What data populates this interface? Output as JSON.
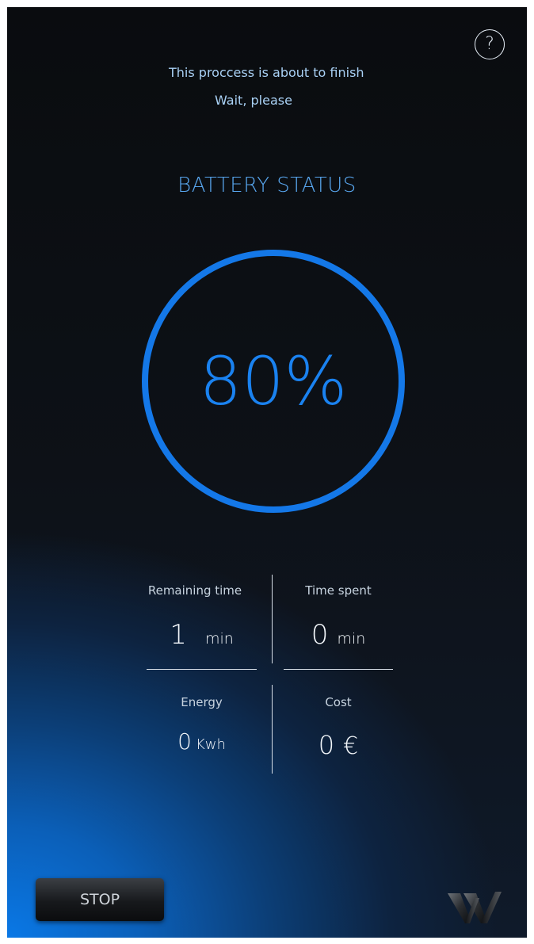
{
  "header": {
    "message_line1": "This proccess is about to finish",
    "message_line2": "Wait, please",
    "help_label": "?"
  },
  "battery": {
    "title": "BATTERY STATUS",
    "percent_text": "80%",
    "percent_value": 80,
    "ring_color": "#1478e8"
  },
  "stats": {
    "remaining_time": {
      "label": "Remaining time",
      "value": "1",
      "unit": "min"
    },
    "time_spent": {
      "label": "Time spent",
      "value": "0",
      "unit": "min"
    },
    "energy": {
      "label": "Energy",
      "value": "0",
      "unit": "Kwh"
    },
    "cost": {
      "label": "Cost",
      "value": "0",
      "unit": "€"
    }
  },
  "footer": {
    "stop_label": "STOP",
    "logo_icon": "w-logo-icon"
  },
  "colors": {
    "accent": "#1a82f0",
    "text_light": "#a9d1f5"
  }
}
